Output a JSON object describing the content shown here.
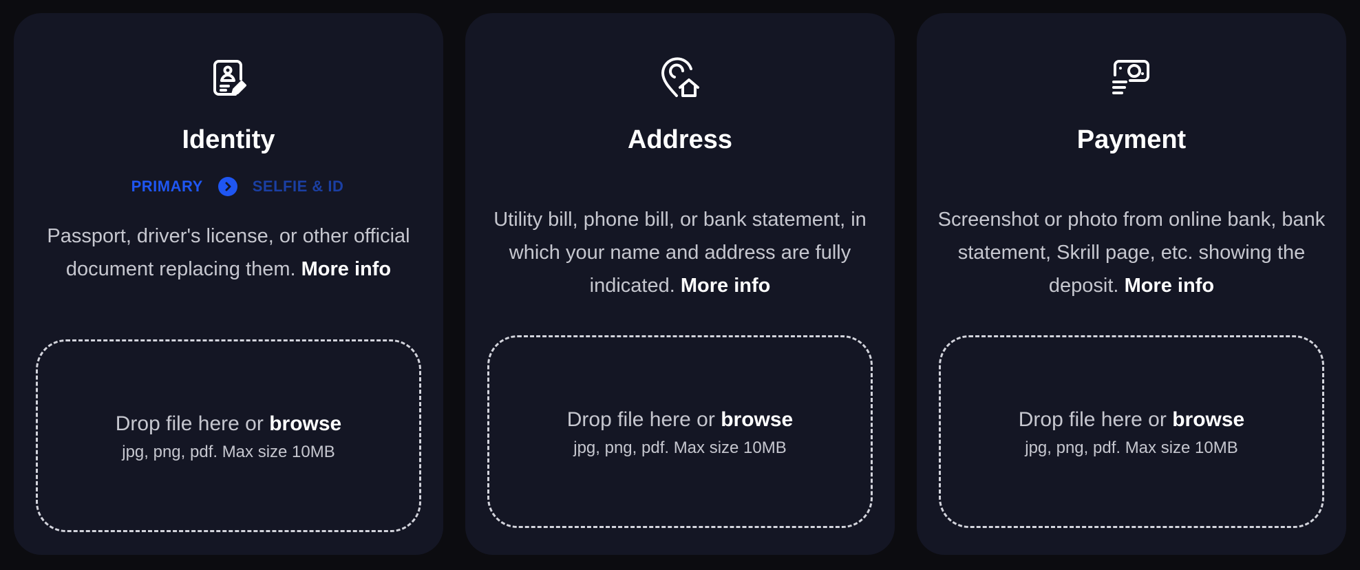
{
  "cards": [
    {
      "icon": "id-document-icon",
      "title": "Identity",
      "steps": {
        "primary": "PRIMARY",
        "secondary": "SELFIE & ID"
      },
      "description": "Passport, driver's license, or other official document replacing them.",
      "more_info": "More info",
      "drop_text": "Drop file here or",
      "browse_label": "browse",
      "drop_note": "jpg, png, pdf. Max size 10MB"
    },
    {
      "icon": "location-home-icon",
      "title": "Address",
      "description": "Utility bill, phone bill, or bank statement, in which your name and address are fully indicated.",
      "more_info": "More info",
      "drop_text": "Drop file here or",
      "browse_label": "browse",
      "drop_note": "jpg, png, pdf. Max size 10MB"
    },
    {
      "icon": "payment-icon",
      "title": "Payment",
      "description": "Screenshot or photo from online bank, bank statement, Skrill page, etc. showing the deposit.",
      "more_info": "More info",
      "drop_text": "Drop file here or",
      "browse_label": "browse",
      "drop_note": "jpg, png, pdf. Max size 10MB"
    }
  ],
  "colors": {
    "background": "#0c0c10",
    "card": "#141624",
    "accent": "#1f56f2",
    "accent_dim": "#1b3fa3",
    "text_muted": "#c6c7cf",
    "text_strong": "#ffffff"
  }
}
